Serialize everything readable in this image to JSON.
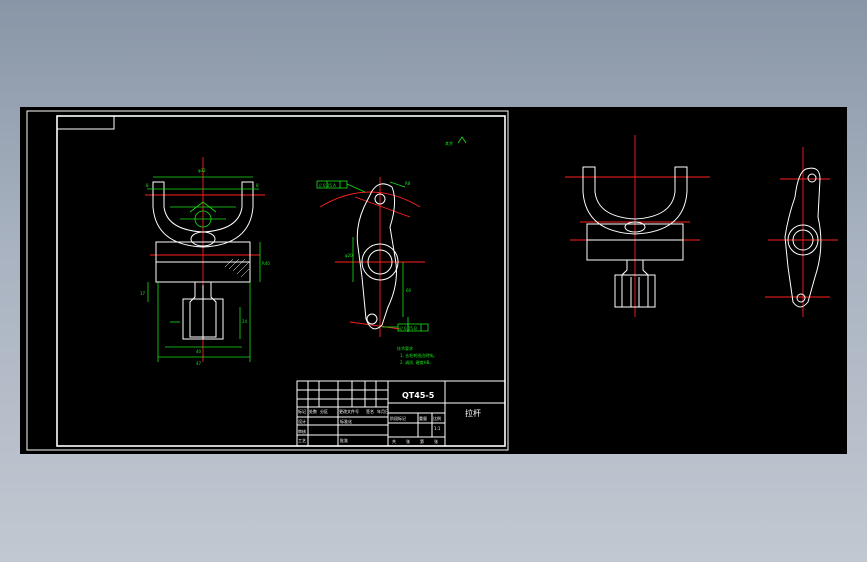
{
  "title_block": {
    "drawing_number": "QT45-5",
    "part_name": "拉杆",
    "scale": "1:1",
    "row_labels": [
      "标记",
      "设计",
      "审核",
      "工艺"
    ],
    "column_labels": [
      "处数",
      "分区",
      "更改文件号",
      "签名",
      "年月日"
    ],
    "stage_labels": [
      "阶段标记",
      "重量",
      "比例"
    ],
    "sheet_labels": [
      "共",
      "张",
      "第",
      "张"
    ],
    "approve_label": "批准",
    "standard_label": "标准化"
  },
  "tech_notes": {
    "heading": "技术要求",
    "items": [
      "1. 去毛刺锐边倒钝。",
      "2. 调质, 硬度HB。"
    ]
  },
  "roughness_note": "其余",
  "tolerance_frames": [
    "// 0.05 A",
    "// 0.05 B"
  ],
  "colors": {
    "background": "#000000",
    "outline": "#ffffff",
    "centerline": "#ff2020",
    "dimension": "#19e219"
  }
}
